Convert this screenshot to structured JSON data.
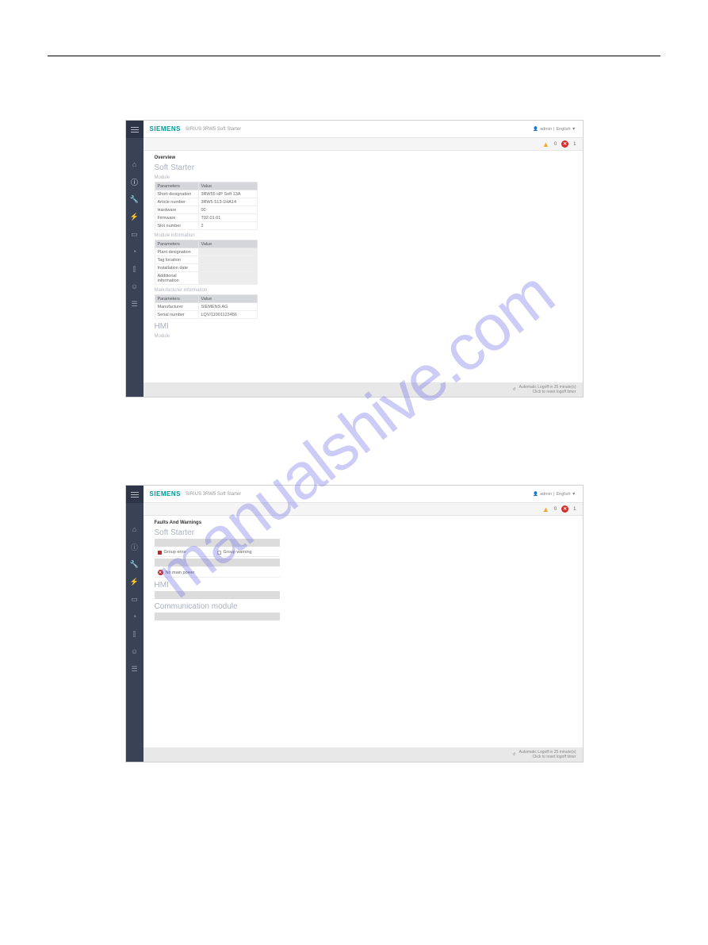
{
  "watermark": "manualshive.com",
  "shot1": {
    "brand": "SIEMENS",
    "brand_sub": "SIRIUS 3RW5 Soft Starter",
    "user": "admin",
    "lang": "English ▼",
    "warn_count": "0",
    "err_count": "1",
    "breadcrumb": "Overview",
    "section": "Soft Starter",
    "sub_module": "Module",
    "table1": {
      "header_param": "Parameters",
      "header_value": "Value",
      "rows": [
        {
          "p": "Short designation",
          "v": "3RW55 HP Soft 13A"
        },
        {
          "p": "Article number",
          "v": "3RW5 513-1HA14"
        },
        {
          "p": "Hardware",
          "v": "00"
        },
        {
          "p": "Firmware",
          "v": "T02.01.01"
        },
        {
          "p": "Slot number",
          "v": "2"
        }
      ]
    },
    "sub_modinfo": "Module information",
    "table2": {
      "header_param": "Parameters",
      "header_value": "Value",
      "rows": [
        {
          "p": "Plant designation",
          "v": ""
        },
        {
          "p": "Tag location",
          "v": ""
        },
        {
          "p": "Installation date",
          "v": ""
        },
        {
          "p": "Additional information",
          "v": ""
        }
      ]
    },
    "sub_mfr": "Manufacturer information",
    "table3": {
      "header_param": "Parameters",
      "header_value": "Value",
      "rows": [
        {
          "p": "Manufacturer",
          "v": "SIEMENS AG"
        },
        {
          "p": "Serial number",
          "v": "LQV/11001123456"
        }
      ]
    },
    "section_hmi": "HMI",
    "sub_hmi": "Module",
    "footer_line1": "Automatic Logoff in 25 minute(s)",
    "footer_line2": "Click to reset logoff timer"
  },
  "shot2": {
    "brand": "SIEMENS",
    "brand_sub": "SIRIUS 3RW5 Soft Starter",
    "user": "admin",
    "lang": "English ▼",
    "warn_count": "0",
    "err_count": "1",
    "breadcrumb": "Faults And Warnings",
    "section": "Soft Starter",
    "group_error": "Group error",
    "group_warning": "Group warning",
    "no_main_power": "No main power",
    "section_hmi": "HMI",
    "section_comm": "Communication module",
    "footer_line1": "Automatic Logoff in 25 minute(s)",
    "footer_line2": "Click to reset logoff timer"
  }
}
